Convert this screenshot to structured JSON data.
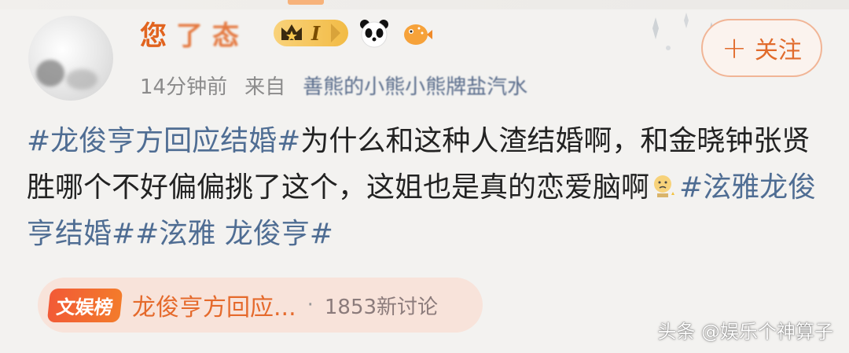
{
  "post": {
    "username_parts": [
      "您",
      "了",
      "态"
    ],
    "vip_level": "I",
    "time": "14分钟前",
    "from_label": "来自",
    "source": "善熊的小熊小熊牌盐汽水",
    "follow_label": "关注",
    "content": {
      "line_segments": [
        {
          "type": "tag",
          "text": "#龙俊亨方回应结婚#"
        },
        {
          "type": "text",
          "text": "为什么和这种人渣结婚啊，和金晓钟张贤胜哪个不好偏偏挑了这个，这姐也是真的恋爱脑啊"
        },
        {
          "type": "emoji",
          "name": "crying-face-icon"
        },
        {
          "type": "tag",
          "text": "#泫雅龙俊亨结婚#"
        },
        {
          "type": "tag",
          "text": "#泫雅 龙俊亨#"
        }
      ]
    },
    "trend": {
      "badge": "文娱榜",
      "title": "龙俊亨方回应...",
      "separator": "·",
      "count": "1853新讨论"
    }
  },
  "watermark": "头条 @娱乐个神算子",
  "colors": {
    "accent": "#e16b2c",
    "tag": "#4f6d93",
    "text": "#222222",
    "meta": "#8b8b8b",
    "background": "#f3f2f0"
  }
}
